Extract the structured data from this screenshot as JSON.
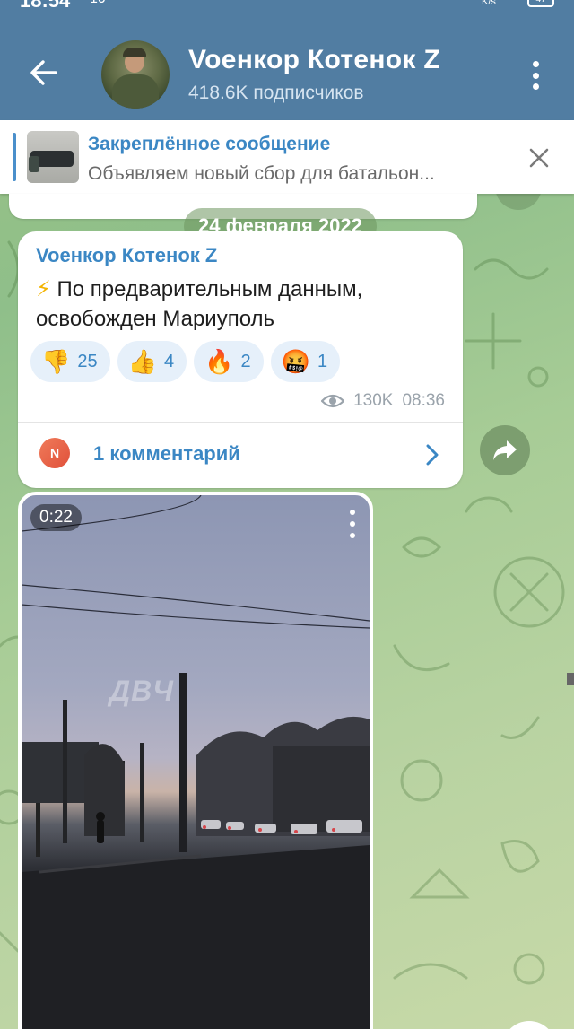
{
  "status_bar": {
    "time": "18:54",
    "network": "10",
    "speed": "K/s",
    "battery": "47"
  },
  "header": {
    "title": "Voенкор Котенок Z",
    "subtitle": "418.6K подписчиков"
  },
  "pinned": {
    "title": "Закреплённое сообщение",
    "text": "Объявляем новый сбор для батальон..."
  },
  "date_chip": "24 февраля 2022",
  "message": {
    "author": "Voенкор Котенок Z",
    "emoji": "⚡",
    "text": "По предварительным данным, освобожден Мариуполь",
    "reactions": [
      {
        "emoji": "👎",
        "count": "25"
      },
      {
        "emoji": "👍",
        "count": "4"
      },
      {
        "emoji": "🔥",
        "count": "2"
      },
      {
        "emoji": "🤬",
        "count": "1"
      }
    ],
    "views": "130K",
    "time": "08:36",
    "commenter_initial": "N",
    "comments": "1 комментарий"
  },
  "video": {
    "duration": "0:22",
    "watermark": "ДВЧ"
  },
  "colors": {
    "header_bg": "#517da2",
    "accent": "#3b87c4",
    "reaction_bg": "#e6f0fa"
  },
  "icons": [
    "back-arrow-icon",
    "more-vertical-icon",
    "close-icon",
    "eye-icon",
    "chevron-right-icon",
    "share-icon"
  ]
}
